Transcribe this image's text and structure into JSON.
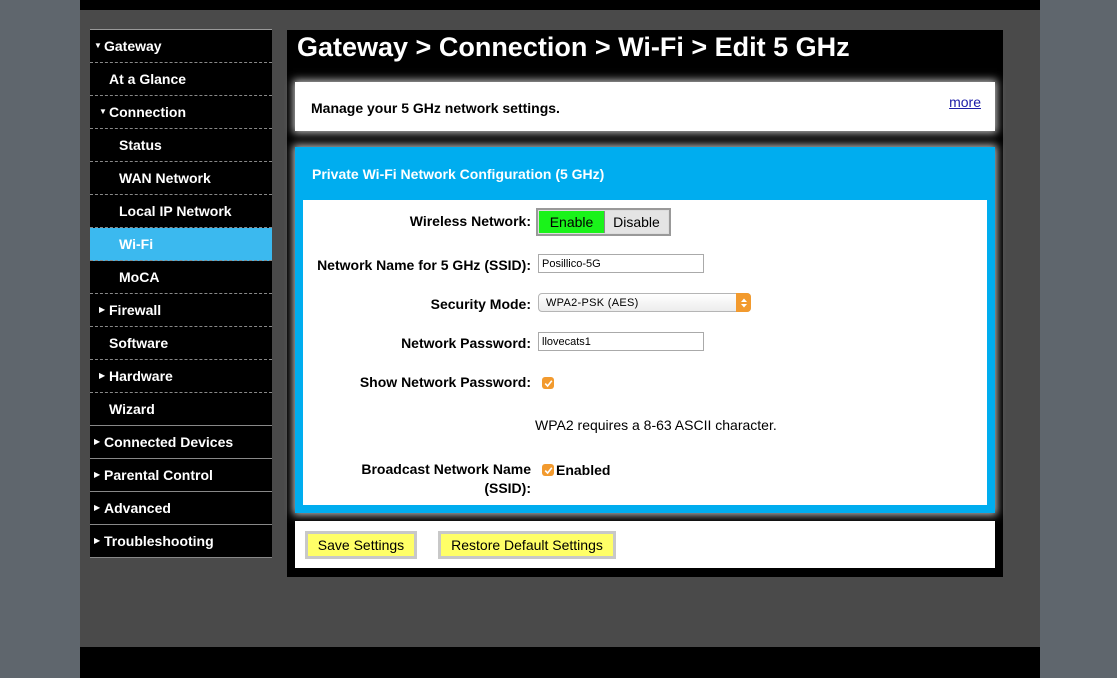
{
  "nav": {
    "items": [
      {
        "label": "Gateway",
        "caret": "▼"
      },
      {
        "label": "At a Glance"
      },
      {
        "label": "Connection",
        "caret": "▼"
      },
      {
        "label": "Status"
      },
      {
        "label": "WAN Network"
      },
      {
        "label": "Local IP Network"
      },
      {
        "label": "Wi-Fi",
        "active": true
      },
      {
        "label": "MoCA"
      },
      {
        "label": "Firewall",
        "caret": "▶"
      },
      {
        "label": "Software"
      },
      {
        "label": "Hardware",
        "caret": "▶"
      },
      {
        "label": "Wizard"
      },
      {
        "label": "Connected Devices",
        "caret": "▶"
      },
      {
        "label": "Parental Control",
        "caret": "▶"
      },
      {
        "label": "Advanced",
        "caret": "▶"
      },
      {
        "label": "Troubleshooting",
        "caret": "▶"
      }
    ]
  },
  "page": {
    "title": "Gateway > Connection > Wi-Fi > Edit 5 GHz",
    "intro": "Manage your 5 GHz network settings.",
    "more": "more"
  },
  "config": {
    "title": "Private Wi-Fi Network Configuration (5 GHz)",
    "wireless_label": "Wireless Network:",
    "enable": "Enable",
    "disable": "Disable",
    "ssid_label": "Network Name for 5 GHz (SSID):",
    "ssid_value": "Posillico-5G",
    "security_label": "Security Mode:",
    "security_value": "WPA2-PSK (AES)",
    "password_label": "Network Password:",
    "password_value": "llovecats1",
    "show_password_label": "Show Network Password:",
    "show_password_checked": true,
    "note": "WPA2 requires a 8-63 ASCII character.",
    "broadcast_label_line1": "Broadcast Network Name",
    "broadcast_label_line2": "(SSID):",
    "broadcast_checked": true,
    "broadcast_status": "Enabled"
  },
  "actions": {
    "save": "Save Settings",
    "restore": "Restore Default Settings"
  },
  "colors": {
    "accent_blue": "#00adef",
    "nav_active": "#3bb9ef",
    "enable_green": "#1af31a",
    "button_yellow": "#ffff67",
    "checkbox_orange": "#f29a2e"
  }
}
